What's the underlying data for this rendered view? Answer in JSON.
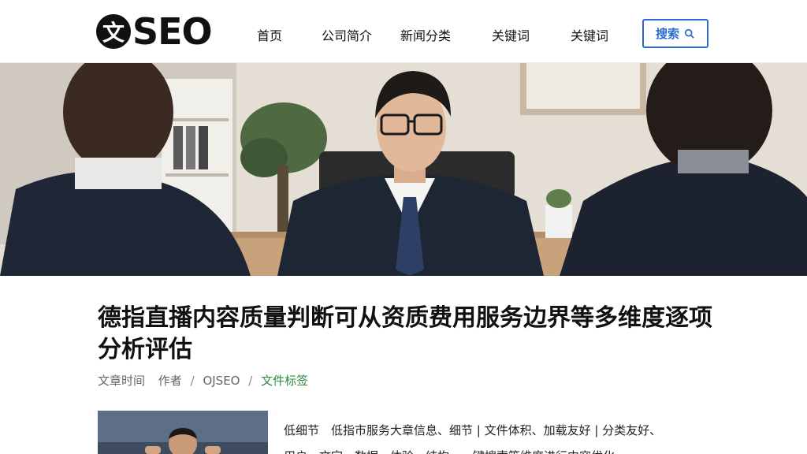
{
  "header": {
    "logo_mark": "文",
    "logo_text": "SEO",
    "nav": [
      "首页",
      "公司简介",
      "新闻分类",
      "关键词",
      "关键词"
    ],
    "search_label": "搜索"
  },
  "article": {
    "title": "德指直播内容质量判断可从资质费用服务边界等多维度逐项分析评估",
    "meta_time": "文章时间",
    "meta_author": "作者",
    "meta_site": "OJSEO",
    "meta_tags": "文件标签",
    "summary": "低细节　低指市服务大章信息、细节 | 文件体积、加载友好 | 分类友好、",
    "summary_line2": "用户、文字、数据、体验、结构、一键搜索等维度进行内容优化"
  },
  "colors": {
    "accent": "#2e6bd0",
    "tag_green": "#2e8b3e"
  }
}
